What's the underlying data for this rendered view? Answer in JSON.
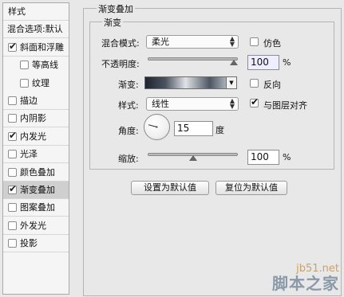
{
  "sidebar": {
    "header": "样式",
    "items": [
      {
        "label": "混合选项:默认",
        "checkbox": false
      },
      {
        "label": "斜面和浮雕",
        "checkbox": true,
        "checked": true
      },
      {
        "label": "等高线",
        "checkbox": true,
        "checked": false,
        "indent": true
      },
      {
        "label": "纹理",
        "checkbox": true,
        "checked": false,
        "indent": true
      },
      {
        "label": "描边",
        "checkbox": true,
        "checked": false
      },
      {
        "label": "内阴影",
        "checkbox": true,
        "checked": false
      },
      {
        "label": "内发光",
        "checkbox": true,
        "checked": true
      },
      {
        "label": "光泽",
        "checkbox": true,
        "checked": false
      },
      {
        "label": "颜色叠加",
        "checkbox": true,
        "checked": false
      },
      {
        "label": "渐变叠加",
        "checkbox": true,
        "checked": true,
        "selected": true
      },
      {
        "label": "图案叠加",
        "checkbox": true,
        "checked": false
      },
      {
        "label": "外发光",
        "checkbox": true,
        "checked": false
      },
      {
        "label": "投影",
        "checkbox": true,
        "checked": false
      }
    ]
  },
  "panel": {
    "title": "渐变叠加",
    "subtitle": "渐变",
    "blend_mode_label": "混合模式:",
    "blend_mode_value": "柔光",
    "dither_label": "仿色",
    "dither_checked": false,
    "opacity_label": "不透明度:",
    "opacity_value": "100",
    "opacity_unit": "%",
    "opacity_fraction": 1.0,
    "gradient_label": "渐变:",
    "reverse_label": "反向",
    "reverse_checked": false,
    "style_label": "样式:",
    "style_value": "线性",
    "align_label": "与图层对齐",
    "align_checked": true,
    "angle_label": "角度:",
    "angle_value": "15",
    "angle_unit": "度",
    "scale_label": "缩放:",
    "scale_value": "100",
    "scale_unit": "%",
    "scale_fraction": 0.5,
    "make_default_label": "设置为默认值",
    "reset_default_label": "复位为默认值"
  },
  "watermark": {
    "site": "jb51.net",
    "brand": "脚本之家"
  }
}
